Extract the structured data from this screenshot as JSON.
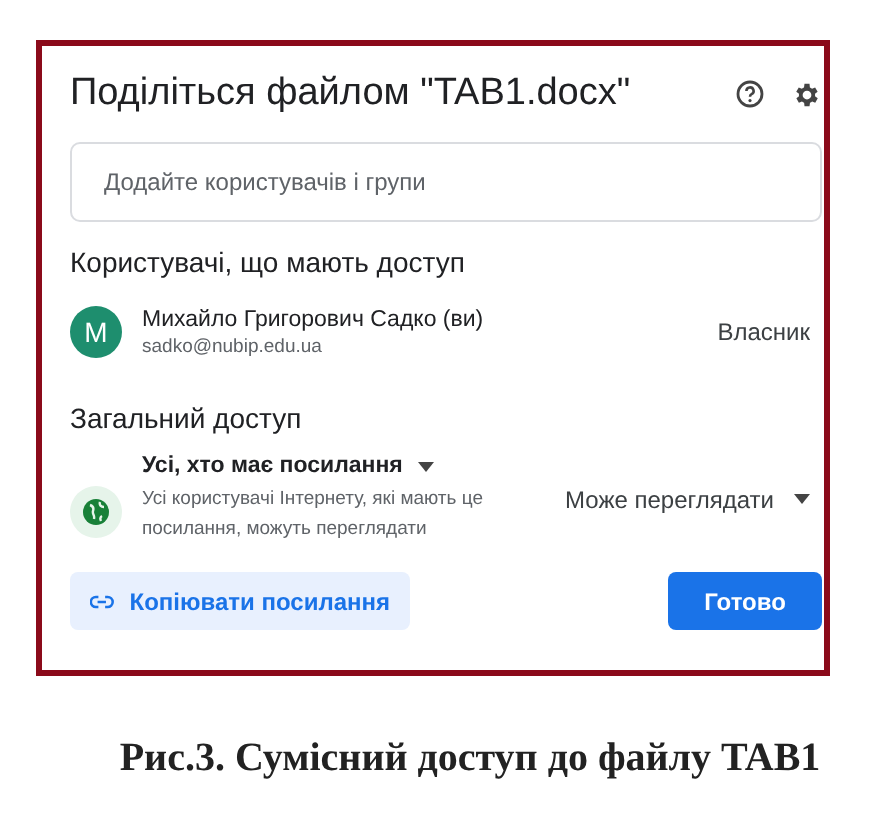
{
  "dialog": {
    "title": "Поділіться файлом \"TAB1.docx\"",
    "add_field": {
      "placeholder": "Додайте користувачів і групи"
    },
    "people_heading": "Користувачі, що мають доступ",
    "people": [
      {
        "initial": "M",
        "name": "Михайло Григорович Садко (ви)",
        "email": "sadko@nubip.edu.ua",
        "role": "Власник",
        "color": "#1e8e6e"
      }
    ],
    "general_heading": "Загальний доступ",
    "general": {
      "scope": "Усі, хто має посилання",
      "description": "Усі користувачі Інтернету, які мають це посилання, можуть переглядати",
      "permission": "Може переглядати"
    },
    "buttons": {
      "copy_link": "Копіювати посилання",
      "done": "Готово"
    }
  },
  "caption": "Рис.3. Сумісний доступ до файлу TAB1"
}
